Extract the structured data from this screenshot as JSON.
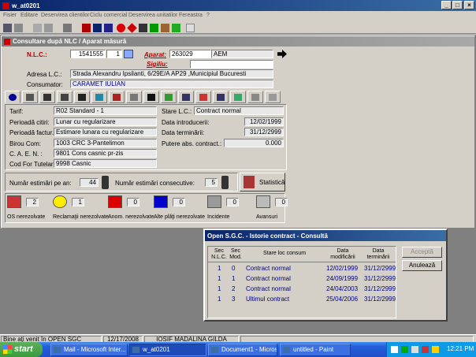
{
  "app": {
    "title": "w_at0201",
    "menu": [
      "Fisier",
      "Editare",
      "Deservirea clientilor",
      "Ciclu comercial",
      "Deservirea unitatilor",
      "Fereastra",
      "?"
    ]
  },
  "child_window": {
    "title": "Consultare după NLC / Aparat măsură",
    "nlc_label": "N.L.C.:",
    "nlc_value": "1541555",
    "nlc_suffix": "1",
    "aparat_label": "Aparat:",
    "aparat_value": "263029",
    "aparat_type": "AEM",
    "sigiliu_label": "Sigiliu:",
    "sigiliu_value": "",
    "adresa_label": "Adresa L.C.:",
    "adresa_value": "Strada Alexandru Ipsilanti, 6/29E/A AP29 ,Municipiul Bucuresti",
    "consumator_label": "Consumator:",
    "consumator_value": "CARAMET  IULIAN"
  },
  "details": {
    "tarif_label": "Tarif:",
    "tarif_value": "R02 Standard - 1",
    "stare_label": "Stare L.C.:",
    "stare_value": "Contract normal",
    "perioada_citiri_label": "Perioadă citiri:",
    "perioada_citiri_value": "Lunar cu regularizare",
    "data_intro_label": "Data introducerii:",
    "data_intro_value": "12/02/1999",
    "perioada_factur_label": "Perioadă factur.:",
    "perioada_factur_value": "Estimare lunara cu regularizare",
    "data_term_label": "Data terminării:",
    "data_term_value": "31/12/2999",
    "birou_label": "Birou Com:",
    "birou_value": "1003  CRC 3-Pantelimon",
    "putere_label": "Putere abs. contract.:",
    "putere_value": "0.000",
    "caen_label": "C. A. E. N. :",
    "caen_value": "9801  Cons casnic pr-zis",
    "cod_tutelar_label": "Cod For Tutelar:",
    "cod_tutelar_value": "9998  Casnic"
  },
  "estimari": {
    "pe_an_label": "Număr estimări pe an:",
    "pe_an_value": "44",
    "consecutive_label": "Număr estimări consecutive:",
    "consecutive_value": "5",
    "statistica_label": "Statistică"
  },
  "status_counters": [
    {
      "label": "OS nerezolvate",
      "value": "2",
      "icon": "os-icon",
      "color": "#cc3333"
    },
    {
      "label": "Reclamaţii nerezolvate",
      "value": "1",
      "icon": "smiley-icon",
      "color": "#ffee00"
    },
    {
      "label": "Anom. nerezolvate",
      "value": "0",
      "icon": "anomaly-icon",
      "color": "#dd0000"
    },
    {
      "label": "Alte plăţi nerezolvate",
      "value": "0",
      "icon": "payment-icon",
      "color": "#0000cc"
    },
    {
      "label": "Incidente",
      "value": "0",
      "icon": "incident-icon",
      "color": "#9a9a9a"
    },
    {
      "label": "Avansuri",
      "value": "0",
      "icon": "advance-icon",
      "color": "#bbbbbb"
    }
  ],
  "dialog": {
    "title": "Open S.G.C. - Istorie contract - Consultă",
    "columns": [
      "Sec N.L.C.",
      "Sec Mod.",
      "Stare loc consum",
      "Data modificării",
      "Data terminării"
    ],
    "rows": [
      {
        "sec_nlc": "1",
        "sec_mod": "0",
        "stare": "Contract normal",
        "data_mod": "12/02/1999",
        "data_term": "31/12/2999"
      },
      {
        "sec_nlc": "1",
        "sec_mod": "1",
        "stare": "Contract normal",
        "data_mod": "24/09/1999",
        "data_term": "31/12/2999"
      },
      {
        "sec_nlc": "1",
        "sec_mod": "2",
        "stare": "Contract normal",
        "data_mod": "24/04/2003",
        "data_term": "31/12/2999"
      },
      {
        "sec_nlc": "1",
        "sec_mod": "3",
        "stare": "Ultimul contract",
        "data_mod": "25/04/2006",
        "data_term": "31/12/2999"
      }
    ],
    "accept_label": "Acceptă",
    "cancel_label": "Anulează"
  },
  "statusbar": {
    "message": "Bine aţi venit în OPEN SGC",
    "date": "12/17/2008",
    "user": "IOSIF MADALINA GILDA"
  },
  "taskbar": {
    "start_label": "start",
    "tasks": [
      "Mail - Microsoft Inter...",
      "w_at0201",
      "Document1 - Microsof...",
      "untitled - Paint"
    ],
    "clock": "12:21 PM"
  },
  "colors": {
    "title_active": "#0a246a",
    "field_text_blue": "#000080",
    "taskbar_blue": "#245edb",
    "start_green": "#3c9a3c"
  }
}
